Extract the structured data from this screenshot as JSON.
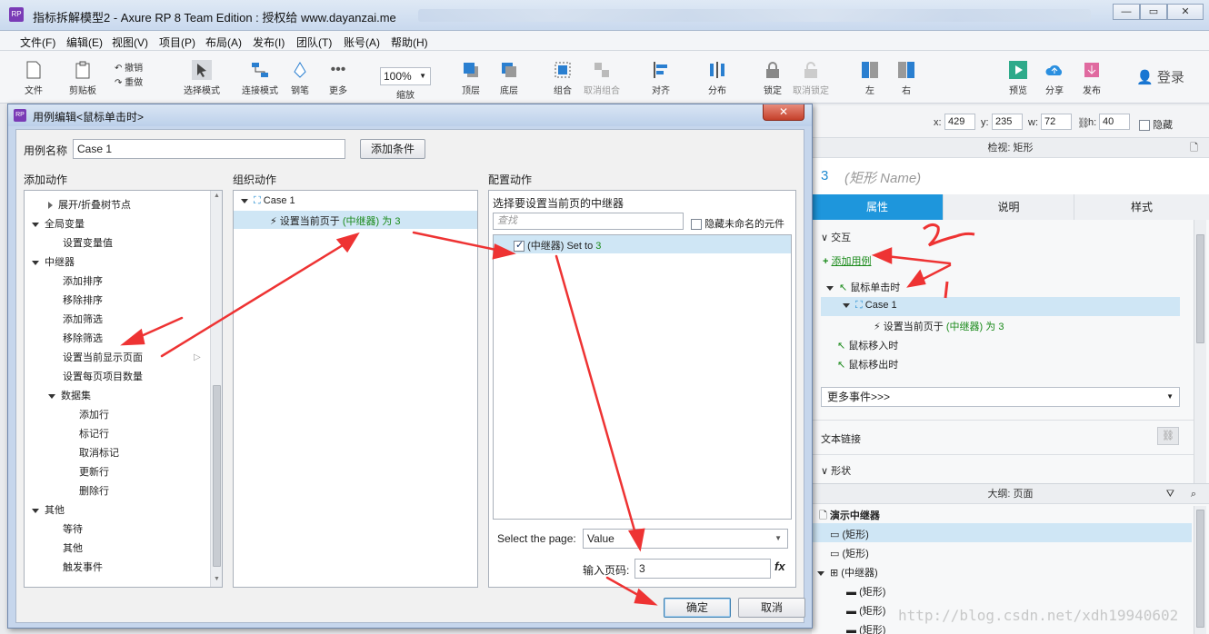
{
  "window": {
    "title": "指标拆解模型2 - Axure RP 8 Team Edition : 授权给 www.dayanzai.me",
    "logo": "RP"
  },
  "menu": [
    "文件(F)",
    "编辑(E)",
    "视图(V)",
    "项目(P)",
    "布局(A)",
    "发布(I)",
    "团队(T)",
    "账号(A)",
    "帮助(H)"
  ],
  "toolbar": {
    "file": "文件",
    "clipboard": "剪贴板",
    "undo": "撤销",
    "redo": "重做",
    "select_mode": "选择模式",
    "connect_mode": "连接模式",
    "pen": "钢笔",
    "more": "更多",
    "zoom_value": "100%",
    "zoom_label": "缩放",
    "top": "顶层",
    "bottom": "底层",
    "group": "组合",
    "ungroup": "取消组合",
    "align": "对齐",
    "distribute": "分布",
    "lock": "锁定",
    "unlock": "取消锁定",
    "left": "左",
    "right": "右",
    "preview": "预览",
    "share": "分享",
    "publish": "发布",
    "login": "登录"
  },
  "coords": {
    "x_label": "x:",
    "x": "429",
    "y_label": "y:",
    "y": "235",
    "w_label": "w:",
    "w": "72",
    "h_label": "h:",
    "h": "40",
    "hide_label": "隐藏"
  },
  "inspector": {
    "header": "检视: 矩形",
    "shape_number": "3",
    "shape_name_placeholder": "(矩形 Name)",
    "tabs": [
      "属性",
      "说明",
      "样式"
    ],
    "interaction": "交互",
    "add_case": "添加用例",
    "event_click": "鼠标单击时",
    "case_name": "Case 1",
    "action_prefix": "设置当前页于",
    "action_target": "(中继器)",
    "action_suffix": "为",
    "action_value": "3",
    "event_mouse_in": "鼠标移入时",
    "event_mouse_out": "鼠标移出时",
    "more_events": "更多事件>>>",
    "text_link": "文本链接",
    "shape_section": "形状"
  },
  "outline": {
    "header": "大纲: 页面",
    "page": "演示中继器",
    "items": [
      "(矩形)",
      "(矩形)",
      "(中继器)",
      "(矩形)",
      "(矩形)",
      "(矩形)"
    ]
  },
  "dialog": {
    "title": "用例编辑<鼠标单击时>",
    "case_name_label": "用例名称",
    "case_name_value": "Case 1",
    "add_condition": "添加条件",
    "col_add_action": "添加动作",
    "col_organize": "组织动作",
    "col_configure": "配置动作",
    "actions_tree": [
      {
        "label": "展开/折叠树节点",
        "indent": 1,
        "toggle": "right"
      },
      {
        "label": "全局变量",
        "indent": 0,
        "toggle": "down"
      },
      {
        "label": "设置变量值",
        "indent": 2,
        "toggle": ""
      },
      {
        "label": "中继器",
        "indent": 0,
        "toggle": "down"
      },
      {
        "label": "添加排序",
        "indent": 2,
        "toggle": ""
      },
      {
        "label": "移除排序",
        "indent": 2,
        "toggle": ""
      },
      {
        "label": "添加筛选",
        "indent": 2,
        "toggle": ""
      },
      {
        "label": "移除筛选",
        "indent": 2,
        "toggle": ""
      },
      {
        "label": "设置当前显示页面",
        "indent": 2,
        "toggle": ""
      },
      {
        "label": "设置每页项目数量",
        "indent": 2,
        "toggle": ""
      },
      {
        "label": "数据集",
        "indent": 1,
        "toggle": "down"
      },
      {
        "label": "添加行",
        "indent": 3,
        "toggle": ""
      },
      {
        "label": "标记行",
        "indent": 3,
        "toggle": ""
      },
      {
        "label": "取消标记",
        "indent": 3,
        "toggle": ""
      },
      {
        "label": "更新行",
        "indent": 3,
        "toggle": ""
      },
      {
        "label": "删除行",
        "indent": 3,
        "toggle": ""
      },
      {
        "label": "其他",
        "indent": 0,
        "toggle": "down"
      },
      {
        "label": "等待",
        "indent": 2,
        "toggle": ""
      },
      {
        "label": "其他",
        "indent": 2,
        "toggle": ""
      },
      {
        "label": "触发事件",
        "indent": 2,
        "toggle": ""
      }
    ],
    "organize_case": "Case 1",
    "organize_action_prefix": "设置当前页于",
    "organize_action_target": "(中继器)",
    "organize_action_suffix": "为",
    "organize_action_value": "3",
    "configure_title": "选择要设置当前页的中继器",
    "search_placeholder": "查找",
    "hide_unnamed": "隐藏未命名的元件",
    "repeater_item": "(中继器) Set to",
    "repeater_value": "3",
    "select_page_label": "Select the page:",
    "select_page_value": "Value",
    "page_number_label": "输入页码:",
    "page_number_value": "3",
    "fx": "fx",
    "ok": "确定",
    "cancel": "取消"
  },
  "watermark": "http://blog.csdn.net/xdh19940602",
  "colors": {
    "selected_tab": "#1e96dc",
    "selected_row": "#cfe6f5",
    "annotation_red": "#ee3333",
    "action_green": "#1a8a1a"
  }
}
